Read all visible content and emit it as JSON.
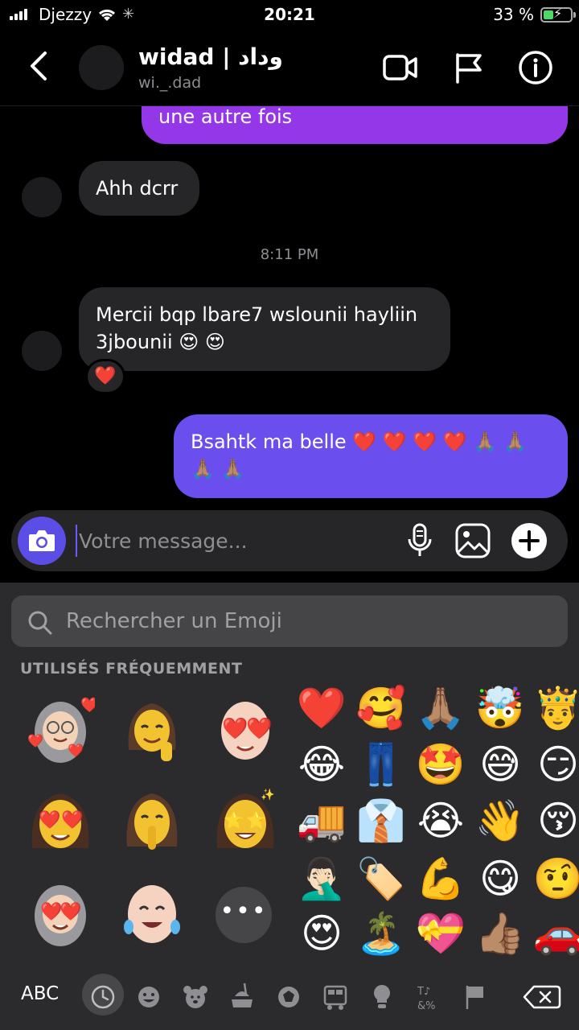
{
  "status_bar": {
    "carrier": "Djezzy",
    "time": "20:21",
    "battery": "33 %",
    "battery_level": 0.33
  },
  "header": {
    "contact_name": "widad | وداد",
    "contact_handle": "wi._.dad"
  },
  "messages": [
    {
      "direction": "outgoing",
      "text": "une autre fois"
    },
    {
      "direction": "incoming",
      "text": "Ahh dcrr"
    },
    {
      "type": "timestamp",
      "text": "8:11 PM"
    },
    {
      "direction": "incoming",
      "text": "Mercii bqp lbare7 wslounii hayliin",
      "text2": "3jbounii 😍 😍",
      "reaction": "❤️"
    },
    {
      "direction": "outgoing",
      "text": "Bsahtk ma belle ❤️ ❤️ ❤️ ❤️ 🙏🏽 🙏🏽",
      "text2": "🙏🏽 🙏🏽"
    }
  ],
  "composer": {
    "placeholder": "Votre message..."
  },
  "emoji_keyboard": {
    "search_placeholder": "Rechercher un Emoji",
    "section_title": "UTILISÉS FRÉQUEMMENT",
    "more_label": "•••",
    "emoji_rows": [
      [
        "❤️",
        "🥰",
        "🙏🏽",
        "🤯",
        "🤴"
      ],
      [
        "😂",
        "👖",
        "🤩",
        "😅",
        "😏"
      ],
      [
        "🚚",
        "👔",
        "😭",
        "👋",
        "😚"
      ],
      [
        "🤦🏻‍♂️",
        "🏷️",
        "💪",
        "😋",
        "🤨"
      ],
      [
        "😍",
        "🏝️",
        "💝",
        "👍🏽",
        "🚗"
      ]
    ],
    "abc_label": "ABC",
    "categories": [
      "recent-icon",
      "smileys-icon",
      "animals-icon",
      "food-icon",
      "activity-icon",
      "travel-icon",
      "objects-icon",
      "symbols-icon",
      "flags-icon",
      "delete-icon"
    ]
  },
  "colors": {
    "accent": "#5b4ee6",
    "outgoing_top": "#9437e8",
    "outgoing_bottom": "#6a4fee",
    "incoming": "#262628",
    "keyboard": "#2b2b2d"
  }
}
